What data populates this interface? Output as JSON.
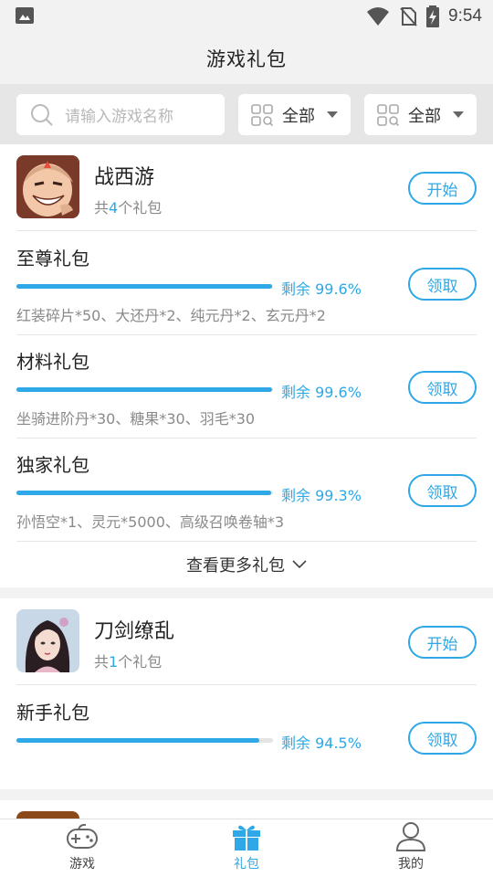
{
  "status_bar": {
    "time": "9:54"
  },
  "header": {
    "title": "游戏礼包"
  },
  "filters": {
    "search_placeholder": "请输入游戏名称",
    "filter1_label": "全部",
    "filter2_label": "全部"
  },
  "games": [
    {
      "name": "战西游",
      "count_prefix": "共",
      "count": "4",
      "count_suffix": "个礼包",
      "start_label": "开始",
      "packs": [
        {
          "name": "至尊礼包",
          "remaining": "剩余 99.6%",
          "remaining_fraction": 0.996,
          "contents": "红装碎片*50、大还丹*2、纯元丹*2、玄元丹*2",
          "claim_label": "领取"
        },
        {
          "name": "材料礼包",
          "remaining": "剩余 99.6%",
          "remaining_fraction": 0.996,
          "contents": "坐骑进阶丹*30、糖果*30、羽毛*30",
          "claim_label": "领取"
        },
        {
          "name": "独家礼包",
          "remaining": "剩余 99.3%",
          "remaining_fraction": 0.993,
          "contents": "孙悟空*1、灵元*5000、高级召唤卷轴*3",
          "claim_label": "领取"
        }
      ],
      "more_label": "查看更多礼包"
    },
    {
      "name": "刀剑缭乱",
      "count_prefix": "共",
      "count": "1",
      "count_suffix": "个礼包",
      "start_label": "开始",
      "packs": [
        {
          "name": "新手礼包",
          "remaining": "剩余 94.5%",
          "remaining_fraction": 0.945,
          "claim_label": "领取"
        }
      ]
    }
  ],
  "tabbar": {
    "items": [
      {
        "label": "游戏",
        "icon": "gamepad-icon",
        "active": false
      },
      {
        "label": "礼包",
        "icon": "gift-icon",
        "active": true
      },
      {
        "label": "我的",
        "icon": "person-icon",
        "active": false
      }
    ]
  },
  "colors": {
    "accent": "#2ea8e6",
    "background": "#f2f2f2"
  }
}
